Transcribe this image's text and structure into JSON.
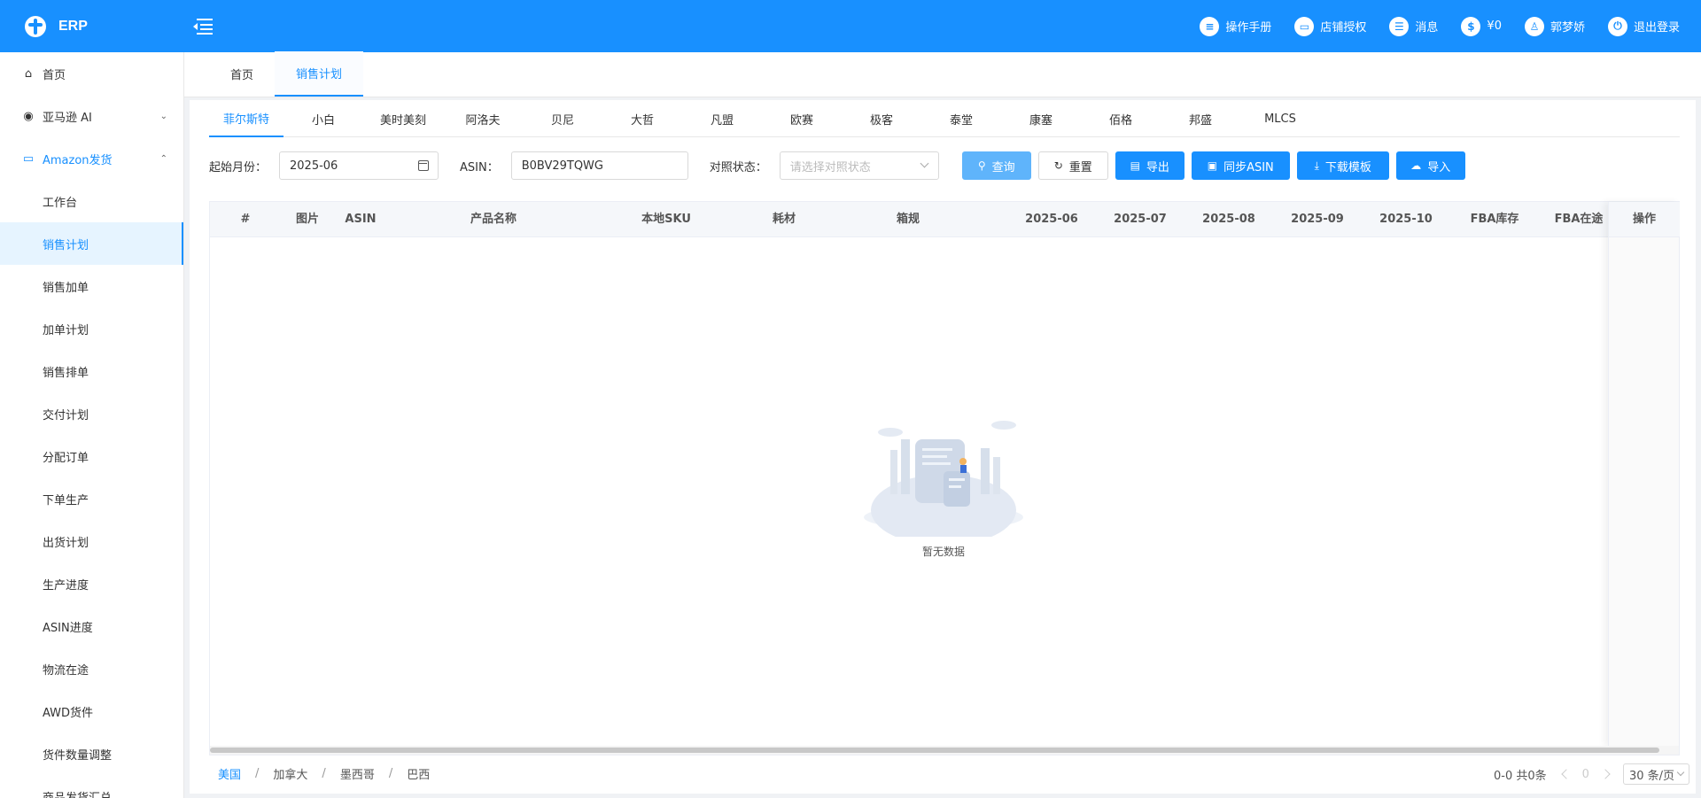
{
  "header": {
    "logo_text": "ERP",
    "items": [
      {
        "icon": "manual-icon",
        "glyph": "≡",
        "label": "操作手册"
      },
      {
        "icon": "store-icon",
        "glyph": "▭",
        "label": "店铺授权"
      },
      {
        "icon": "message-icon",
        "glyph": "☰",
        "label": "消息"
      },
      {
        "icon": "wallet-icon",
        "glyph": "$",
        "label": "¥0"
      },
      {
        "icon": "user-icon",
        "glyph": "♙",
        "label": "郭梦娇"
      },
      {
        "icon": "logout-icon",
        "glyph": "⏻",
        "label": "退出登录"
      }
    ]
  },
  "sidebar": {
    "items": [
      {
        "label": "首页",
        "icon": "home-icon"
      },
      {
        "label": "亚马逊 AI",
        "icon": "ai-icon"
      },
      {
        "label": "Amazon发货",
        "icon": "folder-icon"
      }
    ],
    "sub_items": [
      "工作台",
      "销售计划",
      "销售加单",
      "加单计划",
      "销售排单",
      "交付计划",
      "分配订单",
      "下单生产",
      "出货计划",
      "生产进度",
      "ASIN进度",
      "物流在途",
      "AWD货件",
      "货件数量调整",
      "商品发货汇总"
    ],
    "active_sub": "销售计划"
  },
  "page_tabs": [
    "首页",
    "销售计划"
  ],
  "store_tabs": [
    "菲尔斯特",
    "小白",
    "美时美刻",
    "阿洛夫",
    "贝尼",
    "大哲",
    "凡盟",
    "欧赛",
    "极客",
    "泰堂",
    "康塞",
    "佰格",
    "邦盛",
    "MLCS"
  ],
  "filters": {
    "start_month_label": "起始月份：",
    "start_month_value": "2025-06",
    "asin_label": "ASIN：",
    "asin_value": "B0BV29TQWG",
    "compare_label": "对照状态：",
    "compare_placeholder": "请选择对照状态"
  },
  "buttons": {
    "query": "查询",
    "reset": "重置",
    "export": "导出",
    "sync": "同步ASIN",
    "download": "下载模板",
    "import": "导入"
  },
  "table": {
    "columns": [
      "#",
      "图片",
      "ASIN",
      "产品名称",
      "本地SKU",
      "耗材",
      "箱规",
      "2025-06",
      "2025-07",
      "2025-08",
      "2025-09",
      "2025-10",
      "FBA库存",
      "FBA在途"
    ],
    "fixed_column": "操作",
    "empty_text": "暂无数据"
  },
  "countries": [
    "美国",
    "加拿大",
    "墨西哥",
    "巴西"
  ],
  "active_country": "美国",
  "pagination": {
    "summary": "0-0 共0条",
    "current_page": "0",
    "page_size": "30 条/页"
  },
  "colors": {
    "primary": "#1890ff",
    "active_bg": "#e6f4ff"
  }
}
